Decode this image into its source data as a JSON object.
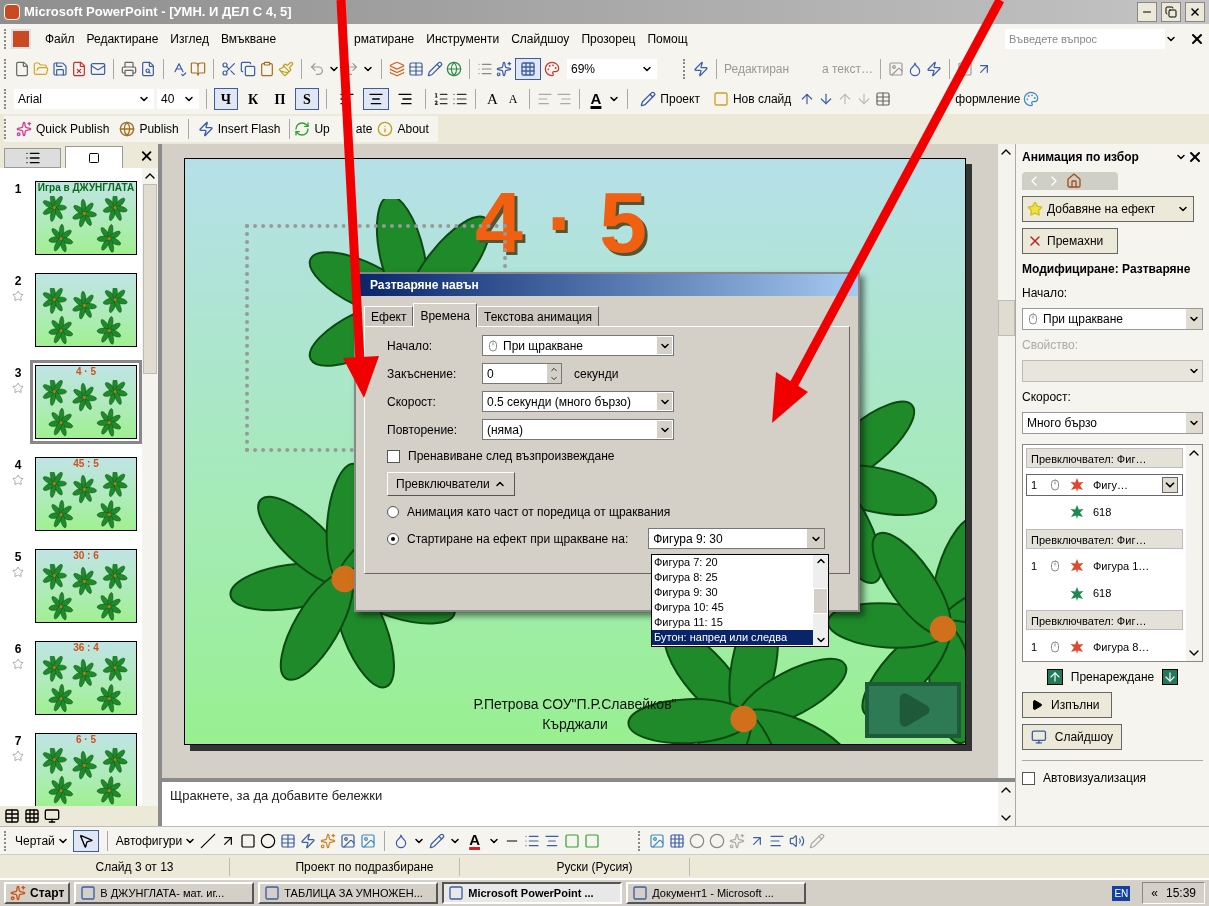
{
  "window": {
    "title": "Microsoft PowerPoint - [УМН. И ДЕЛ С 4, 5]"
  },
  "menu": {
    "items": [
      "Файл",
      "Редактиране",
      "Изглед",
      "Вмъкване",
      "рматиране",
      "Инструменти",
      "Слайдшоу",
      "Прозорец",
      "Помощ"
    ],
    "help_placeholder": "Въведете въпрос"
  },
  "standard_toolbar": {
    "zoom": "69%",
    "grid_on": true,
    "text_edit": [
      "Редактиран",
      "а текст…"
    ]
  },
  "formatting_toolbar": {
    "font": "Arial",
    "size": "40",
    "styles": [
      {
        "label": "Ч",
        "pressed": true
      },
      {
        "label": "К",
        "pressed": false
      },
      {
        "label": "П",
        "pressed": false
      },
      {
        "label": "S",
        "pressed": true
      }
    ],
    "align": [
      {
        "kind": "left",
        "pressed": false
      },
      {
        "kind": "center",
        "pressed": true
      },
      {
        "kind": "right",
        "pressed": false
      }
    ],
    "font_color_letter": "A",
    "grow_letter": "A",
    "shrink_letter": "A",
    "buttons": [
      "Проект",
      "Нов слайд"
    ],
    "design_fragment": "формление"
  },
  "addin_toolbar": {
    "buttons": [
      "Quick Publish",
      "Publish",
      "Insert Flash"
    ],
    "update_parts": [
      "Up",
      "ate"
    ],
    "about": "About"
  },
  "slides": [
    {
      "number": "1",
      "starred": false,
      "selected": false,
      "title": "Игра в ДЖУНГЛАТА",
      "color": "#0c6a14"
    },
    {
      "number": "2",
      "starred": true,
      "selected": false
    },
    {
      "number": "3",
      "starred": true,
      "selected": true,
      "title": "4 · 5",
      "color": "#d0501a"
    },
    {
      "number": "4",
      "starred": true,
      "selected": false,
      "title": "45 : 5",
      "color": "#d0501a"
    },
    {
      "number": "5",
      "starred": true,
      "selected": false,
      "title": "30 : 6",
      "color": "#d0501a"
    },
    {
      "number": "6",
      "starred": true,
      "selected": false,
      "title": "36 : 4",
      "color": "#d0501a"
    },
    {
      "number": "7",
      "starred": true,
      "selected": false,
      "title": "6 · 5",
      "color": "#d0501a"
    }
  ],
  "slide": {
    "title": "4 · 5",
    "author": "Р.Петрова СОУ\"П.Р.Славейков\"",
    "town": "Кърджали"
  },
  "notes": {
    "placeholder": "Щракнете, за да добавите бележки"
  },
  "dialog": {
    "title": "Разтваряне навън",
    "tabs": [
      {
        "label": "Ефект",
        "selected": false
      },
      {
        "label": "Времена",
        "selected": true
      },
      {
        "label": "Текстова анимация",
        "selected": false
      }
    ],
    "start_label": "Начало:",
    "start_value": "При щракване",
    "delay_label": "Закъснение:",
    "delay_value": "0",
    "delay_unit": "секунди",
    "speed_label": "Скорост:",
    "speed_value": "0.5 секунди (много бързо)",
    "repeat_label": "Повторение:",
    "repeat_value": "(няма)",
    "rewind": {
      "label": "Пренавиване след възпроизвеждане",
      "checked": false
    },
    "triggers_button": "Превключватели",
    "options": [
      {
        "label": "Анимация като част от поредица от щраквания",
        "selected": false
      },
      {
        "label": "Стартиране на ефект при щракване на:",
        "selected": true
      }
    ],
    "trigger_value": "Фигура 9: 30",
    "trigger_list": [
      {
        "label": "Фигура 7: 20",
        "selected": false
      },
      {
        "label": "Фигура 8: 25",
        "selected": false
      },
      {
        "label": "Фигура 9: 30",
        "selected": false
      },
      {
        "label": "Фигура 10: 45",
        "selected": false
      },
      {
        "label": "Фигура 11: 15",
        "selected": false
      },
      {
        "label": "Бутон: напред или следва",
        "selected": true
      }
    ]
  },
  "task_pane": {
    "title": "Анимация по избор",
    "add_effect": "Добавяне на ефект",
    "remove": "Премахни",
    "modify": "Модифициране: Разтваряне",
    "start_label": "Начало:",
    "start_value": "При щракване",
    "property_label": "Свойство:",
    "speed_label": "Скорост:",
    "speed_value": "Много бързо",
    "effects": [
      {
        "kind": "trigger",
        "label": "Превключвател: Фиг…"
      },
      {
        "kind": "effect",
        "number": "1",
        "label": "Фигу…",
        "color": "#e0482b",
        "selected": true
      },
      {
        "kind": "effect",
        "label": "618",
        "color": "#1a8a50",
        "selected": false
      },
      {
        "kind": "trigger",
        "label": "Превключвател: Фиг…"
      },
      {
        "kind": "effect",
        "number": "1",
        "label": "Фигура 1…",
        "color": "#e0482b",
        "selected": false
      },
      {
        "kind": "effect",
        "label": "618",
        "color": "#1a8a50",
        "selected": false
      },
      {
        "kind": "trigger",
        "label": "Превключвател: Фиг…"
      },
      {
        "kind": "effect",
        "number": "1",
        "label": "Фигура 8…",
        "color": "#e0482b",
        "selected": false
      }
    ],
    "reorder": "Пренареждане",
    "play": "Изпълни",
    "slideshow": "Слайдшоу",
    "autopreview": {
      "label": "Автовизуализация",
      "checked": false
    }
  },
  "drawing_toolbar": {
    "draw": "Чертай",
    "autoshapes": "Автофигури",
    "font_color_letter": "A"
  },
  "status_bar": [
    "Слайд 3 от 13",
    "Проект по подразбиране",
    "Руски (Русия)"
  ],
  "taskbar": {
    "start": "Старт",
    "tasks": [
      {
        "label": "В ДЖУНГЛАТА- мат. иг...",
        "selected": false
      },
      {
        "label": "ТАБЛИЦА ЗА УМНОЖЕН...",
        "selected": false
      },
      {
        "label": "Microsoft PowerPoint ...",
        "selected": true
      },
      {
        "label": "Документ1 - Microsoft ...",
        "selected": false
      }
    ],
    "language": "EN",
    "chevron": "«",
    "time": "15:39"
  }
}
